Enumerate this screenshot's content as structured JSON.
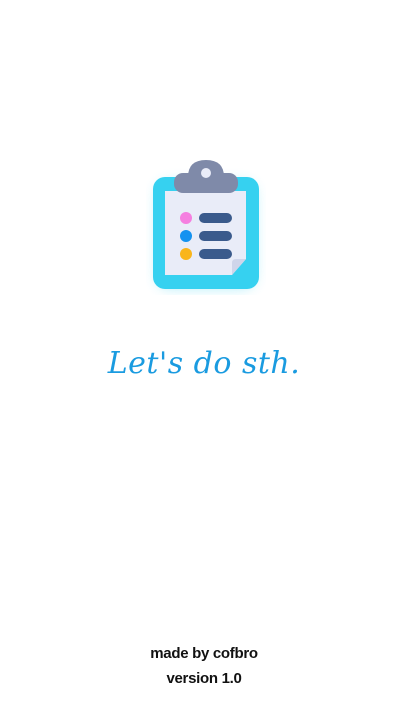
{
  "app_icon": {
    "name": "clipboard-checklist-icon",
    "colors": {
      "board": "#36d1f0",
      "paper": "#e9ecf8",
      "clip": "#7f8aa9",
      "dot_pink": "#f57fe0",
      "dot_blue": "#1492f0",
      "dot_yellow": "#f9b51b",
      "lines": "#3a5a8c"
    }
  },
  "tagline": "Let's do sth.",
  "credits": {
    "author": "made by cofbro",
    "version": "version 1.0"
  },
  "colors": {
    "background": "#ffffff",
    "accent": "#1a9be0",
    "credit_text": "#111111"
  }
}
